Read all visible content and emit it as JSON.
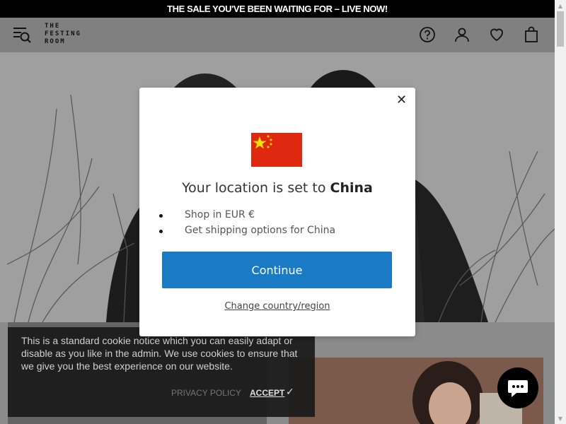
{
  "announcement": {
    "text": "THE SALE YOU'VE BEEN WAITING FOR – LIVE NOW!"
  },
  "header": {
    "logo_lines": [
      "THE",
      "FESTING",
      "ROOM"
    ],
    "icons": [
      "menu-search-icon",
      "help-icon",
      "account-icon",
      "wishlist-icon",
      "bag-icon"
    ]
  },
  "modal": {
    "flag": "china-flag",
    "location_prefix": "Your location is set to",
    "country": "China",
    "bullets": [
      "Shop in EUR €",
      "Get shipping options for China"
    ],
    "continue_label": "Continue",
    "change_label": "Change country/region"
  },
  "cookie": {
    "text": "This is a standard cookie notice which you can easily adapt or disable as you like in the admin. We use cookies to ensure that we give you the best experience on our website.",
    "privacy_label": "PRIVACY POLICY",
    "accept_label": "ACCEPT"
  },
  "colors": {
    "primary_button": "#1a7bc4",
    "announcement_bg": "#000000"
  }
}
